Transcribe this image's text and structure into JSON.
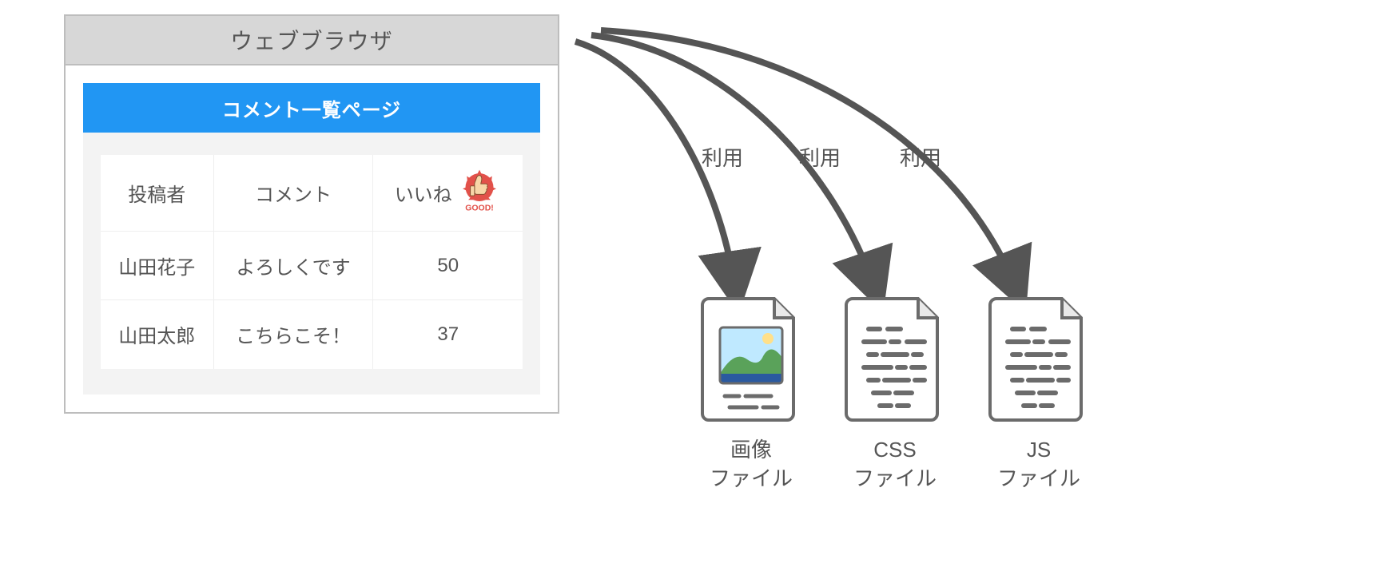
{
  "browser": {
    "title": "ウェブブラウザ"
  },
  "page": {
    "title": "コメント一覧ページ"
  },
  "table": {
    "headers": {
      "poster": "投稿者",
      "comment": "コメント",
      "likes": "いいね",
      "likes_badge": "GOOD!"
    },
    "rows": [
      {
        "poster": "山田花子",
        "comment": "よろしくです",
        "likes": "50"
      },
      {
        "poster": "山田太郎",
        "comment": "こちらこそ！",
        "likes": "37"
      }
    ]
  },
  "arrows": {
    "labels": [
      "利用",
      "利用",
      "利用"
    ]
  },
  "files": {
    "image": {
      "label_line1": "画像",
      "label_line2": "ファイル"
    },
    "css": {
      "label_line1": "CSS",
      "label_line2": "ファイル"
    },
    "js": {
      "label_line1": "JS",
      "label_line2": "ファイル"
    }
  }
}
